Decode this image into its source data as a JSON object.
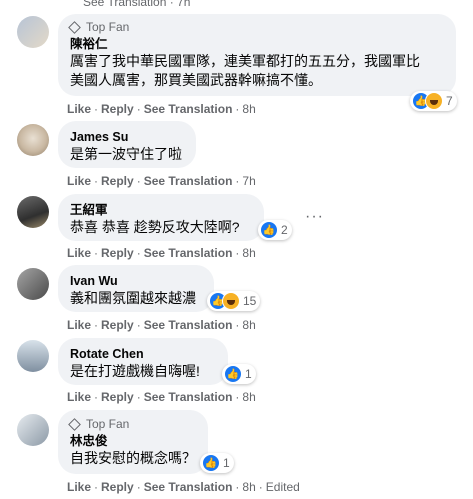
{
  "comments": [
    {
      "badge": "Top Fan",
      "author": "陳裕仁",
      "text": "厲害了我中華民國軍隊，連美軍都打的五五分，我國軍比\n美國人厲害，那買美國武器幹嘛搞不懂。",
      "actions": {
        "like": "Like",
        "reply": "Reply",
        "translate": "See Translation",
        "time": "8h"
      },
      "reactions": {
        "count": "7"
      }
    },
    {
      "author": "James Su",
      "text": "是第一波守住了啦",
      "actions": {
        "like": "Like",
        "reply": "Reply",
        "translate": "See Translation",
        "time": "7h"
      }
    },
    {
      "author": "王紹軍",
      "text": "恭喜 恭喜 趁勢反攻大陸啊?",
      "actions": {
        "like": "Like",
        "reply": "Reply",
        "translate": "See Translation",
        "time": "8h"
      },
      "reactions": {
        "count": "2"
      },
      "more": "···"
    },
    {
      "author": "Ivan Wu",
      "text": "義和團氛圍越來越濃",
      "actions": {
        "like": "Like",
        "reply": "Reply",
        "translate": "See Translation",
        "time": "8h"
      },
      "reactions": {
        "count": "15"
      }
    },
    {
      "author": "Rotate Chen",
      "text": "是在打遊戲機自嗨喔!",
      "actions": {
        "like": "Like",
        "reply": "Reply",
        "translate": "See Translation",
        "time": "8h"
      },
      "reactions": {
        "count": "1"
      }
    },
    {
      "badge": "Top Fan",
      "author": "林忠俊",
      "text": "自我安慰的概念嗎？",
      "actions": {
        "like": "Like",
        "reply": "Reply",
        "translate": "See Translation",
        "time": "8h",
        "edited": "Edited"
      },
      "reactions": {
        "count": "1"
      }
    }
  ],
  "icons": {
    "like": "thumbs-up-icon",
    "haha": "haha-emoji-icon",
    "badge": "diamond-icon"
  },
  "colors": {
    "like": "#1877f2",
    "bubble": "#f0f2f5",
    "meta": "#65676b"
  }
}
